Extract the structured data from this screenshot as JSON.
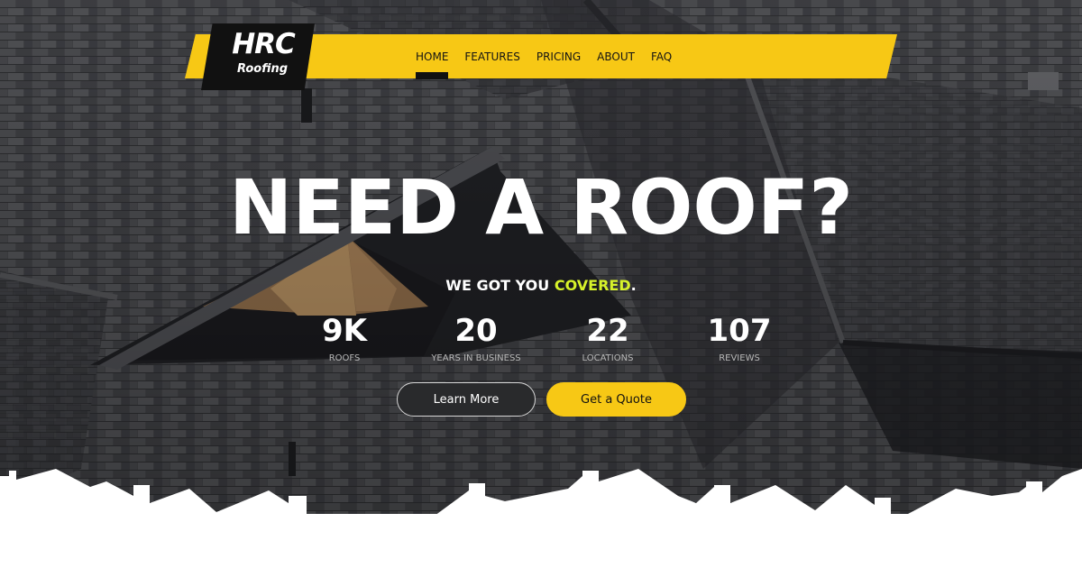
{
  "brand": {
    "name": "HRC",
    "subtitle": "Roofing"
  },
  "nav": {
    "items": [
      {
        "label": "HOME",
        "active": true
      },
      {
        "label": "FEATURES"
      },
      {
        "label": "PRICING"
      },
      {
        "label": "ABOUT"
      },
      {
        "label": "FAQ"
      }
    ]
  },
  "hero": {
    "headline": "NEED A ROOF?",
    "subheadline_start": "WE GOT YOU ",
    "subheadline_accent": "COVERED",
    "subheadline_end": "."
  },
  "stats": [
    {
      "value": "9K",
      "label": "ROOFS"
    },
    {
      "value": "20",
      "label": "YEARS IN BUSINESS"
    },
    {
      "value": "22",
      "label": "LOCATIONS"
    },
    {
      "value": "107",
      "label": "REVIEWS"
    }
  ],
  "buttons": {
    "learn_more": "Learn More",
    "get_quote": "Get a Quote"
  },
  "colors": {
    "accent": "#f7c815",
    "highlight": "#d7f22a",
    "dark": "#111111",
    "roof": "#3a3b3e"
  }
}
